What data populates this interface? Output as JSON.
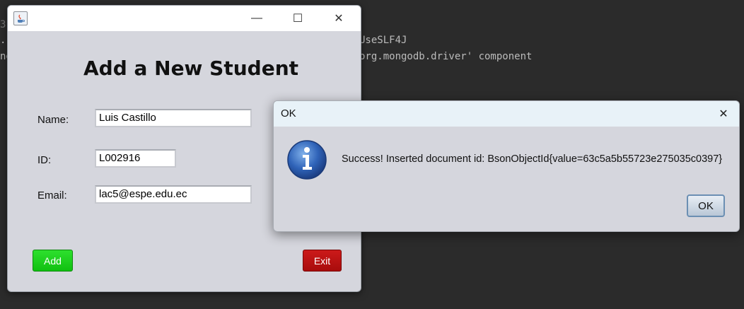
{
  "console": {
    "line1": "3",
    "line2": ".",
    "line3": "ne",
    "line4": "UseSLF4J",
    "line5": "org.mongodb.driver' component"
  },
  "main_window": {
    "heading": "Add a New Student",
    "name_label": "Name:",
    "name_value": "Luis Castillo",
    "id_label": "ID:",
    "id_value": "L002916",
    "email_label": "Email:",
    "email_value": "lac5@espe.edu.ec",
    "add_label": "Add",
    "exit_label": "Exit",
    "minimize_glyph": "—",
    "maximize_glyph": "☐",
    "close_glyph": "✕"
  },
  "dialog": {
    "title": "OK",
    "close_glyph": "✕",
    "message": "Success! Inserted document id: BsonObjectId{value=63c5a5b55723e275035c0397}",
    "ok_label": "OK"
  },
  "colors": {
    "add_button": "#16c816",
    "exit_button": "#b81010",
    "info_icon": "#2f63b8"
  }
}
